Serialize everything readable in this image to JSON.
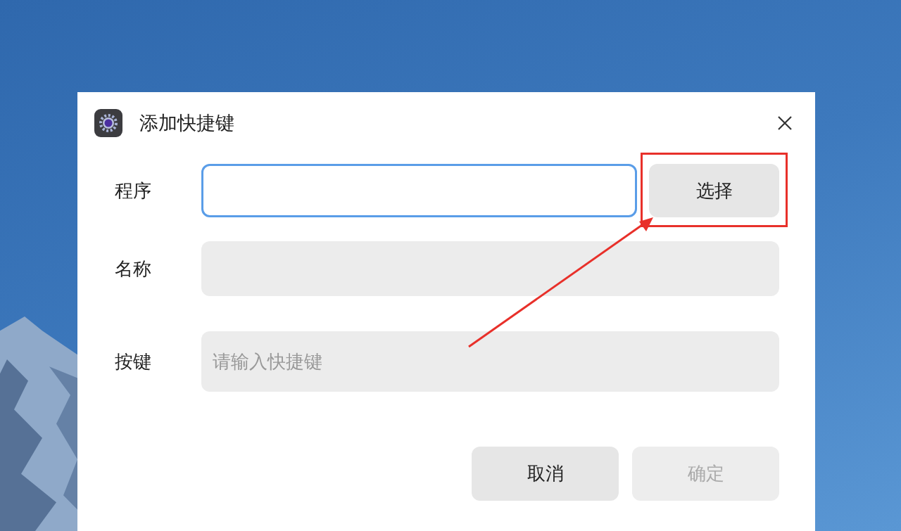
{
  "window": {
    "title": "添加快捷键"
  },
  "fields": [
    {
      "label": "程序",
      "focused": true,
      "button": "选择"
    },
    {
      "label": "名称",
      "focused": false
    },
    {
      "label": "按键",
      "focused": false,
      "placeholder": "请输入快捷键"
    }
  ],
  "buttons": [
    {
      "label": "取消",
      "disabled": false
    },
    {
      "label": "确定",
      "disabled": true
    }
  ]
}
